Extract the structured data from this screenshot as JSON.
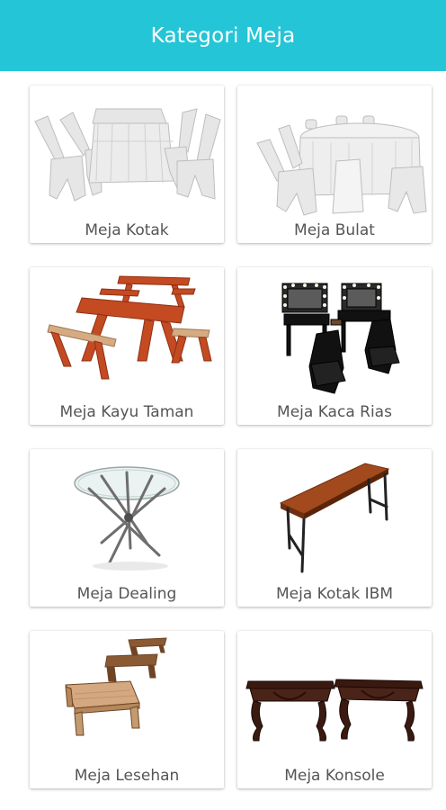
{
  "appbar": {
    "title": "Kategori Meja",
    "color": "#24c5d6"
  },
  "categories": [
    {
      "label": "Meja Kotak",
      "image": "rectangular-table-with-covered-chairs"
    },
    {
      "label": "Meja Bulat",
      "image": "round-table-with-covered-chairs"
    },
    {
      "label": "Meja Kayu Taman",
      "image": "wooden-picnic-tables-with-benches"
    },
    {
      "label": "Meja Kaca Rias",
      "image": "vanity-tables-with-mirrors-and-chairs"
    },
    {
      "label": "Meja Dealing",
      "image": "round-glass-table-with-metal-legs"
    },
    {
      "label": "Meja Kotak IBM",
      "image": "wooden-folding-table"
    },
    {
      "label": "Meja Lesehan",
      "image": "low-floor-tables"
    },
    {
      "label": "Meja Konsole",
      "image": "carved-console-tables"
    }
  ]
}
